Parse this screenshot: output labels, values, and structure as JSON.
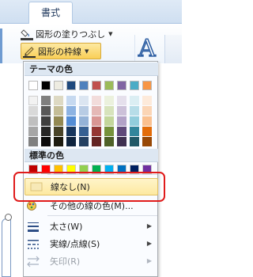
{
  "ribbon": {
    "tab_label": "書式",
    "fill_label": "図形の塗りつぶし",
    "line_label": "図形の枠線"
  },
  "wordart_letter": "A",
  "menu": {
    "theme_header": "テーマの色",
    "standard_header": "標準の色",
    "theme_base_colors": [
      "#ffffff",
      "#000000",
      "#eeece1",
      "#1f497d",
      "#4f81bd",
      "#c0504d",
      "#9bbb59",
      "#8064a2",
      "#4bacc6",
      "#f79646"
    ],
    "theme_shades": [
      [
        "#f2f2f2",
        "#d9d9d9",
        "#bfbfbf",
        "#a6a6a6",
        "#808080"
      ],
      [
        "#7f7f7f",
        "#595959",
        "#3f3f3f",
        "#262626",
        "#0c0c0c"
      ],
      [
        "#ddd9c3",
        "#c4bd97",
        "#938953",
        "#494429",
        "#1d1b10"
      ],
      [
        "#c6d9f0",
        "#8db3e2",
        "#548dd4",
        "#17365d",
        "#0f243e"
      ],
      [
        "#dbe5f1",
        "#b8cce4",
        "#95b3d7",
        "#366092",
        "#244061"
      ],
      [
        "#f2dcdb",
        "#e5b9b7",
        "#d99694",
        "#953734",
        "#632423"
      ],
      [
        "#ebf1dd",
        "#d7e3bc",
        "#c3d69b",
        "#76923c",
        "#4f6128"
      ],
      [
        "#e5e0ec",
        "#ccc1d9",
        "#b2a2c7",
        "#5f497a",
        "#3f3151"
      ],
      [
        "#dbeef3",
        "#b7dde8",
        "#92cddc",
        "#31859b",
        "#205867"
      ],
      [
        "#fdeada",
        "#fbd5b5",
        "#fac08f",
        "#e36c09",
        "#974806"
      ]
    ],
    "standard_colors": [
      "#c00000",
      "#ff0000",
      "#ffc000",
      "#ffff00",
      "#92d050",
      "#00b050",
      "#00b0f0",
      "#0070c0",
      "#002060",
      "#7030a0"
    ],
    "items": {
      "no_line": "線なし(N)",
      "other_colors": "その他の線の色(M)...",
      "weight": "太さ(W)",
      "dashes": "実線/点線(S)",
      "arrows": "矢印(R)"
    }
  }
}
